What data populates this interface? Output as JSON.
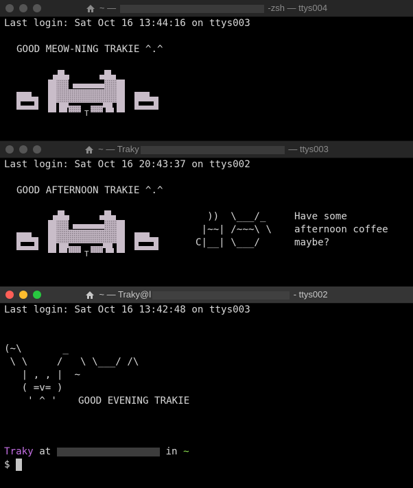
{
  "windows": [
    {
      "title_prefix": "~ —",
      "title_suffix": "-zsh — ttys004",
      "last_login": "Last login: Sat Oct 16 13:44:16 on ttys003",
      "greeting": "GOOD MEOW-NING TRAKIE ^.^"
    },
    {
      "title_prefix": "~ — Traky",
      "title_suffix": "— ttys003",
      "last_login": "Last login: Sat Oct 16 20:43:37 on ttys002",
      "greeting": "GOOD AFTERNOON TRAKIE ^.^",
      "coffee_art": "  ))  \\___/_\n |~~| /~~~\\ \\\nC|__| \\___/",
      "coffee_text": "Have some\nafternoon coffee\nmaybe?"
    },
    {
      "title_prefix": "~ — Traky@l",
      "title_suffix": "- ttys002",
      "last_login": "Last login: Sat Oct 16 13:42:48 on ttys003",
      "cat_art": "(~\\       _\n \\ \\     /   \\ \\___/ /\\\n   | , , |  ~\n   ( =v= )\n    ' ^ '",
      "greeting": "GOOD EVENING TRAKIE",
      "prompt_user": "Traky",
      "prompt_at": "at",
      "prompt_in": "in",
      "prompt_dir": "~",
      "prompt_symbol": "$"
    }
  ]
}
